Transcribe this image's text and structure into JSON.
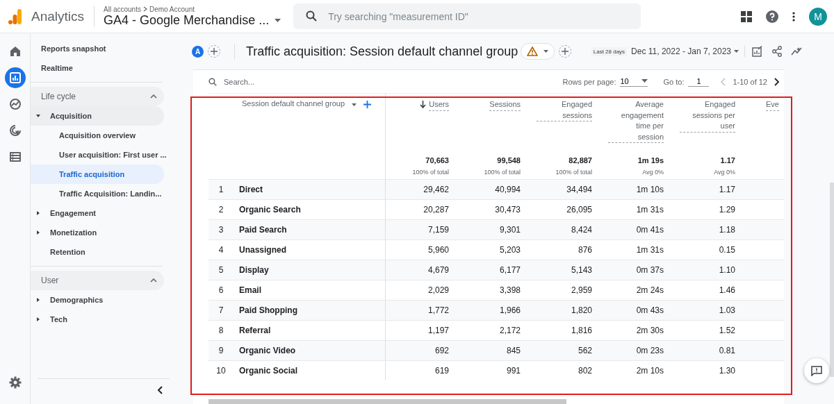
{
  "app": {
    "name": "Analytics"
  },
  "property": {
    "breadcrumb": [
      "All accounts",
      "Demo Account"
    ],
    "title": "GA4 - Google Merchandise ..."
  },
  "search": {
    "placeholder": "Try searching \"measurement ID\""
  },
  "account": {
    "initial": "M"
  },
  "rail": [
    {
      "kind": "home",
      "selected": false
    },
    {
      "kind": "reports",
      "selected": true
    },
    {
      "kind": "explore",
      "selected": false
    },
    {
      "kind": "advertising",
      "selected": false
    },
    {
      "kind": "configure",
      "selected": false
    }
  ],
  "nav": [
    {
      "kind": "link",
      "label": "Reports snapshot",
      "selected": false
    },
    {
      "kind": "link",
      "label": "Realtime",
      "selected": false
    },
    {
      "kind": "section",
      "label": "Life cycle",
      "expanded": true,
      "children": [
        {
          "kind": "group",
          "label": "Acquisition",
          "expanded": true,
          "children": [
            {
              "kind": "link",
              "label": "Acquisition overview",
              "selected": false
            },
            {
              "kind": "link",
              "label": "User acquisition: First user ...",
              "selected": false
            },
            {
              "kind": "link",
              "label": "Traffic acquisition",
              "selected": true
            },
            {
              "kind": "link",
              "label": "Traffic Acquisition: Landin...",
              "selected": false
            }
          ]
        },
        {
          "kind": "group",
          "label": "Engagement",
          "expanded": false
        },
        {
          "kind": "group",
          "label": "Monetization",
          "expanded": false
        },
        {
          "kind": "link",
          "label": "Retention",
          "selected": false
        }
      ]
    },
    {
      "kind": "section",
      "label": "User",
      "expanded": true,
      "children": [
        {
          "kind": "group",
          "label": "Demographics",
          "expanded": false
        },
        {
          "kind": "group",
          "label": "Tech",
          "expanded": false
        }
      ]
    }
  ],
  "report": {
    "comparison": "A",
    "title": "Traffic acquisition: Session default channel group",
    "date_preset": "Last 28 days",
    "date_range": "Dec 11, 2022 - Jan 7, 2023"
  },
  "table": {
    "search_placeholder": "Search...",
    "rows_per_page_label": "Rows per page:",
    "rows_per_page": "10",
    "goto_label": "Go to:",
    "goto": "1",
    "range": "1-10 of 12",
    "dimension": "Session default channel group",
    "columns": [
      {
        "label": "Users",
        "sorted": true,
        "total": "70,663",
        "note": "100% of total"
      },
      {
        "label": "Sessions",
        "sorted": false,
        "total": "99,548",
        "note": "100% of total"
      },
      {
        "label": "Engaged sessions",
        "sorted": false,
        "total": "82,887",
        "note": "100% of total"
      },
      {
        "label": "Average engagement time per session",
        "sorted": false,
        "total": "1m 19s",
        "note": "Avg 0%"
      },
      {
        "label": "Engaged sessions per user",
        "sorted": false,
        "total": "1.17",
        "note": "Avg 0%"
      }
    ],
    "cut_column_label": "Eve",
    "rows": [
      {
        "rank": "1",
        "name": "Direct",
        "cells": [
          "29,462",
          "40,994",
          "34,494",
          "1m 10s",
          "1.17"
        ]
      },
      {
        "rank": "2",
        "name": "Organic Search",
        "cells": [
          "20,287",
          "30,473",
          "26,095",
          "1m 31s",
          "1.29"
        ]
      },
      {
        "rank": "3",
        "name": "Paid Search",
        "cells": [
          "7,159",
          "9,301",
          "8,424",
          "0m 41s",
          "1.18"
        ]
      },
      {
        "rank": "4",
        "name": "Unassigned",
        "cells": [
          "5,960",
          "5,203",
          "876",
          "1m 31s",
          "0.15"
        ]
      },
      {
        "rank": "5",
        "name": "Display",
        "cells": [
          "4,679",
          "6,177",
          "5,143",
          "0m 37s",
          "1.10"
        ]
      },
      {
        "rank": "6",
        "name": "Email",
        "cells": [
          "2,029",
          "3,398",
          "2,959",
          "2m 24s",
          "1.46"
        ]
      },
      {
        "rank": "7",
        "name": "Paid Shopping",
        "cells": [
          "1,772",
          "1,966",
          "1,820",
          "0m 43s",
          "1.03"
        ]
      },
      {
        "rank": "8",
        "name": "Referral",
        "cells": [
          "1,197",
          "2,172",
          "1,816",
          "2m 30s",
          "1.52"
        ]
      },
      {
        "rank": "9",
        "name": "Organic Video",
        "cells": [
          "692",
          "845",
          "562",
          "0m 23s",
          "0.81"
        ]
      },
      {
        "rank": "10",
        "name": "Organic Social",
        "cells": [
          "619",
          "991",
          "802",
          "2m 10s",
          "1.30"
        ]
      }
    ]
  }
}
